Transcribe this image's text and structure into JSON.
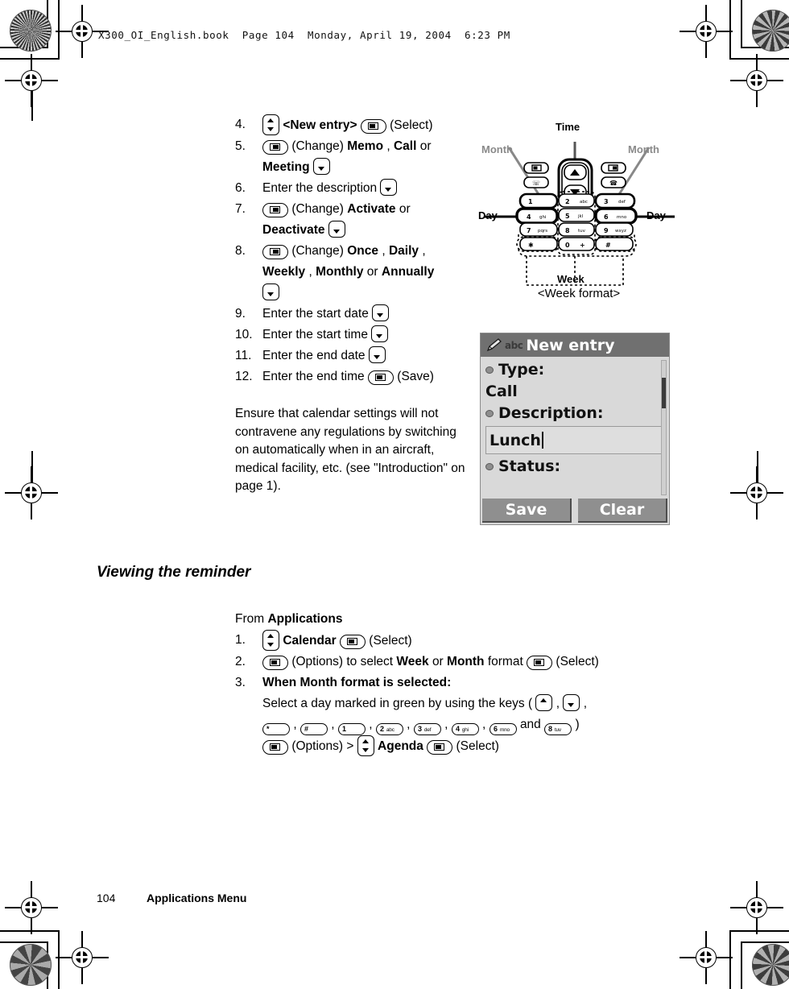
{
  "header": {
    "book_line": "X300_OI_English.book  Page 104  Monday, April 19, 2004  6:23 PM"
  },
  "steps_top": [
    {
      "num": "4.",
      "parts": [
        {
          "t": "icon",
          "icon": "nav-up-down-key"
        },
        {
          "t": "b",
          "v": "<New entry>"
        },
        {
          "t": "icon",
          "icon": "left-soft-key"
        },
        {
          "t": "n",
          "v": "(Select)"
        }
      ]
    },
    {
      "num": "5.",
      "parts": [
        {
          "t": "icon",
          "icon": "right-soft-key"
        },
        {
          "t": "n",
          "v": "(Change)"
        },
        {
          "t": "b",
          "v": "Memo"
        },
        {
          "t": "n",
          "v": ","
        },
        {
          "t": "b",
          "v": "Call"
        },
        {
          "t": "n",
          "v": "or"
        },
        {
          "t": "br"
        },
        {
          "t": "b",
          "v": "Meeting"
        },
        {
          "t": "icon",
          "icon": "down-key"
        }
      ]
    },
    {
      "num": "6.",
      "parts": [
        {
          "t": "n",
          "v": "Enter the description"
        },
        {
          "t": "icon",
          "icon": "down-key"
        }
      ]
    },
    {
      "num": "7.",
      "parts": [
        {
          "t": "icon",
          "icon": "right-soft-key"
        },
        {
          "t": "n",
          "v": "(Change)"
        },
        {
          "t": "b",
          "v": "Activate"
        },
        {
          "t": "n",
          "v": "or"
        },
        {
          "t": "br"
        },
        {
          "t": "b",
          "v": "Deactivate"
        },
        {
          "t": "icon",
          "icon": "down-key"
        }
      ]
    },
    {
      "num": "8.",
      "parts": [
        {
          "t": "icon",
          "icon": "right-soft-key"
        },
        {
          "t": "n",
          "v": "(Change)"
        },
        {
          "t": "b",
          "v": "Once"
        },
        {
          "t": "n",
          "v": ","
        },
        {
          "t": "b",
          "v": "Daily"
        },
        {
          "t": "n",
          "v": ","
        },
        {
          "t": "br"
        },
        {
          "t": "b",
          "v": "Weekly"
        },
        {
          "t": "n",
          "v": ","
        },
        {
          "t": "b",
          "v": "Monthly"
        },
        {
          "t": "n",
          "v": "or"
        },
        {
          "t": "b",
          "v": "Annually"
        },
        {
          "t": "br"
        },
        {
          "t": "icon",
          "icon": "down-key"
        }
      ]
    },
    {
      "num": "9.",
      "parts": [
        {
          "t": "n",
          "v": "Enter the start date"
        },
        {
          "t": "icon",
          "icon": "down-key"
        }
      ]
    },
    {
      "num": "10.",
      "parts": [
        {
          "t": "n",
          "v": "Enter the start time"
        },
        {
          "t": "icon",
          "icon": "down-key"
        }
      ]
    },
    {
      "num": "11.",
      "parts": [
        {
          "t": "n",
          "v": "Enter the end date"
        },
        {
          "t": "icon",
          "icon": "down-key"
        }
      ]
    },
    {
      "num": "12.",
      "parts": [
        {
          "t": "n",
          "v": "Enter the end time"
        },
        {
          "t": "icon",
          "icon": "left-soft-key"
        },
        {
          "t": "n",
          "v": "(Save)"
        }
      ]
    }
  ],
  "note": "Ensure that calendar settings will not contravene any regulations by switching on automatically when in an aircraft, medical facility, etc. (see \"Introduction\" on page 1).",
  "section": {
    "heading": "Viewing the reminder",
    "intro_plain": "From",
    "intro_bold": "Applications"
  },
  "steps_bottom": [
    {
      "num": "1.",
      "parts": [
        {
          "t": "icon",
          "icon": "nav-up-down-key"
        },
        {
          "t": "b",
          "v": "Calendar"
        },
        {
          "t": "icon",
          "icon": "left-soft-key"
        },
        {
          "t": "n",
          "v": "(Select)"
        }
      ]
    },
    {
      "num": "2.",
      "parts": [
        {
          "t": "icon",
          "icon": "left-soft-key"
        },
        {
          "t": "n",
          "v": "(Options) to select"
        },
        {
          "t": "b",
          "v": "Week"
        },
        {
          "t": "n",
          "v": "or"
        },
        {
          "t": "b",
          "v": "Month"
        },
        {
          "t": "n",
          "v": "format"
        },
        {
          "t": "icon",
          "icon": "left-soft-key"
        },
        {
          "t": "n",
          "v": "(Select)"
        }
      ]
    },
    {
      "num": "3.",
      "parts": [
        {
          "t": "b",
          "v": "When Month format is selected:"
        },
        {
          "t": "br"
        },
        {
          "t": "n",
          "v": "Select a day marked in green by using the keys ("
        },
        {
          "t": "icon",
          "icon": "up-key"
        },
        {
          "t": "n",
          "v": ","
        },
        {
          "t": "icon",
          "icon": "down-key"
        },
        {
          "t": "n",
          "v": ","
        },
        {
          "t": "br"
        },
        {
          "t": "key",
          "d": "*",
          "l": "",
          "name": "star-key"
        },
        {
          "t": "n",
          "v": ","
        },
        {
          "t": "key",
          "d": "#",
          "l": "",
          "name": "hash-key"
        },
        {
          "t": "n",
          "v": ","
        },
        {
          "t": "key",
          "d": "1",
          "l": "",
          "name": "key-1"
        },
        {
          "t": "n",
          "v": ","
        },
        {
          "t": "key",
          "d": "2",
          "l": "abc",
          "name": "key-2"
        },
        {
          "t": "n",
          "v": ","
        },
        {
          "t": "key",
          "d": "3",
          "l": "def",
          "name": "key-3"
        },
        {
          "t": "n",
          "v": ","
        },
        {
          "t": "key",
          "d": "4",
          "l": "ghi",
          "name": "key-4"
        },
        {
          "t": "n",
          "v": ","
        },
        {
          "t": "key",
          "d": "6",
          "l": "mno",
          "name": "key-6"
        },
        {
          "t": "n",
          "v": "and"
        },
        {
          "t": "key",
          "d": "8",
          "l": "tuv",
          "name": "key-8"
        },
        {
          "t": "n",
          "v": ")"
        },
        {
          "t": "br"
        },
        {
          "t": "icon",
          "icon": "left-soft-key"
        },
        {
          "t": "n",
          "v": "(Options) >"
        },
        {
          "t": "icon",
          "icon": "nav-up-down-key"
        },
        {
          "t": "b",
          "v": "Agenda"
        },
        {
          "t": "icon",
          "icon": "left-soft-key"
        },
        {
          "t": "n",
          "v": "(Select)"
        }
      ]
    }
  ],
  "diagram": {
    "label_time": "Time",
    "label_month_left": "Month",
    "label_month_right": "Month",
    "label_day_left": "Day",
    "label_day_right": "Day",
    "label_week": "Week",
    "caption": "<Week format>",
    "keys": [
      {
        "d": "1",
        "l": ""
      },
      {
        "d": "2",
        "l": "abc"
      },
      {
        "d": "3",
        "l": "def"
      },
      {
        "d": "4",
        "l": "ghi"
      },
      {
        "d": "5",
        "l": "jkl"
      },
      {
        "d": "6",
        "l": "mno"
      },
      {
        "d": "7",
        "l": "pqrs"
      },
      {
        "d": "8",
        "l": "tuv"
      },
      {
        "d": "9",
        "l": "wxyz"
      },
      {
        "d": "*",
        "l": ""
      },
      {
        "d": "0",
        "l": "+"
      },
      {
        "d": "#",
        "l": ""
      }
    ]
  },
  "lcd": {
    "title": "New entry",
    "input_mode": "abc",
    "fields": [
      {
        "label": "Type:",
        "value": "Call"
      },
      {
        "label": "Description:",
        "value": "Lunch"
      },
      {
        "label": "Status:",
        "value": ""
      }
    ],
    "softkey_left": "Save",
    "softkey_right": "Clear"
  },
  "footer": {
    "page_number": "104",
    "section_name": "Applications Menu"
  }
}
